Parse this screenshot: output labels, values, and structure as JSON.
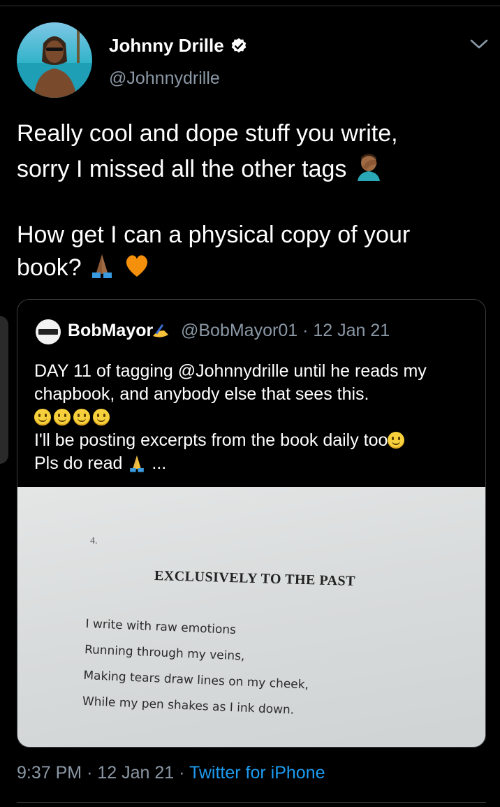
{
  "tweet": {
    "author": {
      "name": "Johnny Drille",
      "handle": "@Johnnydrille"
    },
    "text_line1": "Really cool and dope stuff you write,",
    "text_line2": "sorry I missed all the other tags",
    "text_line3": "How get I can a physical copy of your",
    "text_line4": "book?",
    "timestamp": "9:37 PM",
    "date": "12 Jan 21",
    "source": "Twitter for iPhone"
  },
  "quoted": {
    "name": "BobMayor",
    "handle": "@BobMayor01",
    "date": "12 Jan 21",
    "line1": "DAY 11 of tagging @Johnnydrille until he reads my",
    "line2": "chapbook, and anybody else that sees this.",
    "line4": "I'll be posting excerpts from the book daily too",
    "line5": "Pls do read",
    "ellipsis": "..."
  },
  "book_page": {
    "number": "4.",
    "title": "EXCLUSIVELY TO THE PAST",
    "lines": [
      "I write with raw emotions",
      "Running through my veins,",
      "Making tears draw lines on my cheek,",
      "While my pen shakes as I ink down."
    ]
  },
  "colors": {
    "background": "#000000",
    "muted": "#8b98a5",
    "link": "#1d9bf0",
    "verified": "#ffffff"
  },
  "icons": [
    "verified-badge-icon",
    "chevron-down-icon",
    "facepalm-emoji",
    "pray-emoji",
    "orange-heart-emoji",
    "writing-hand-emoji",
    "smiley-emoji"
  ]
}
